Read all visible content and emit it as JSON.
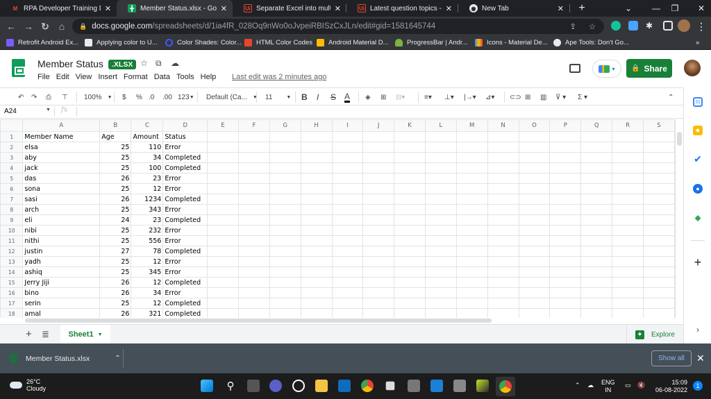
{
  "browser": {
    "tabs": [
      {
        "title": "RPA Developer Training Deta",
        "icon": "gmail-icon",
        "active": false
      },
      {
        "title": "Member Status.xlsx - Google",
        "icon": "sheets-icon",
        "active": true
      },
      {
        "title": "Separate Excel into multiple s",
        "icon": "uipath-icon",
        "active": false
      },
      {
        "title": "Latest question topics - UiPat",
        "icon": "uipath-icon",
        "active": false
      },
      {
        "title": "New Tab",
        "icon": "chrome-icon",
        "active": false
      }
    ],
    "new_tab_label": "+",
    "url_host": "docs.google.com",
    "url_path": "/spreadsheets/d/1ia4fR_028Oq9nWo0oJvpeiRBISzCxJLn/edit#gid=1581645744",
    "bookmarks": [
      {
        "label": "Retrofit Android Ex...",
        "color": "#7b5cff"
      },
      {
        "label": "Applying color to U...",
        "color": "#e8eaed"
      },
      {
        "label": "Color Shades: Color...",
        "color": "#3d5afe"
      },
      {
        "label": "HTML Color Codes",
        "color": "#e8452c"
      },
      {
        "label": "Android Material D...",
        "color": "#fbbc04"
      },
      {
        "label": "ProgressBar | Andr...",
        "color": "#7cb342"
      },
      {
        "label": "Icons - Material De...",
        "color": "#4285f4"
      },
      {
        "label": "Ape Tools: Don't Go...",
        "color": "#e8eaed"
      }
    ],
    "bookmarks_overflow": "»"
  },
  "sheets": {
    "doc_title": "Member Status",
    "format_badge": ".XLSX",
    "menu": [
      "File",
      "Edit",
      "View",
      "Insert",
      "Format",
      "Data",
      "Tools",
      "Help"
    ],
    "last_edit": "Last edit was 2 minutes ago",
    "share_label": "Share",
    "toolbar": {
      "zoom": "100%",
      "currency": "$",
      "percent": "%",
      "dec_decrease": ".0",
      "dec_increase": ".00",
      "more_formats": "123",
      "font": "Default (Ca...",
      "font_size": "11",
      "bold": "B",
      "italic": "I",
      "strike": "S",
      "text_color": "A"
    },
    "name_box": "A24",
    "fx_label": "fx",
    "formula_value": "",
    "columns": [
      "A",
      "B",
      "C",
      "D",
      "E",
      "F",
      "G",
      "H",
      "I",
      "J",
      "K",
      "L",
      "M",
      "N",
      "O",
      "P",
      "Q",
      "R",
      "S"
    ],
    "rows": [
      [
        "Member Name",
        "Age",
        "Amount",
        "Status"
      ],
      [
        "elsa",
        "25",
        "110",
        "Error"
      ],
      [
        "aby",
        "25",
        "34",
        "Completed"
      ],
      [
        "jack",
        "25",
        "100",
        "Completed"
      ],
      [
        "das",
        "26",
        "23",
        "Error"
      ],
      [
        "sona",
        "25",
        "12",
        "Error"
      ],
      [
        "sasi",
        "26",
        "1234",
        "Completed"
      ],
      [
        "arch",
        "25",
        "343",
        "Error"
      ],
      [
        "eli",
        "24",
        "23",
        "Completed"
      ],
      [
        "nibi",
        "25",
        "232",
        "Error"
      ],
      [
        "nithi",
        "25",
        "556",
        "Error"
      ],
      [
        "justin",
        "27",
        "78",
        "Completed"
      ],
      [
        "yadh",
        "25",
        "12",
        "Error"
      ],
      [
        "ashiq",
        "25",
        "345",
        "Error"
      ],
      [
        "Jerry Jiji",
        "26",
        "12",
        "Completed"
      ],
      [
        "bino",
        "26",
        "34",
        "Error"
      ],
      [
        "serin",
        "25",
        "12",
        "Completed"
      ],
      [
        "amal",
        "26",
        "321",
        "Completed"
      ]
    ],
    "sheet_tab": "Sheet1",
    "explore_label": "Explore",
    "side_panel": [
      "calendar-icon",
      "keep-icon",
      "tasks-icon",
      "contacts-icon",
      "maps-icon",
      "add-icon"
    ]
  },
  "downloads": {
    "file_name": "Member Status.xlsx",
    "show_all": "Show all"
  },
  "taskbar": {
    "temperature": "26°C",
    "weather": "Cloudy",
    "lang_1": "ENG",
    "lang_2": "IN",
    "time": "15:09",
    "date": "06-08-2022",
    "notifications": "1"
  },
  "colors": {
    "sheets_green": "#188038",
    "tab_bar": "#202124",
    "download_bar": "#444f57"
  }
}
